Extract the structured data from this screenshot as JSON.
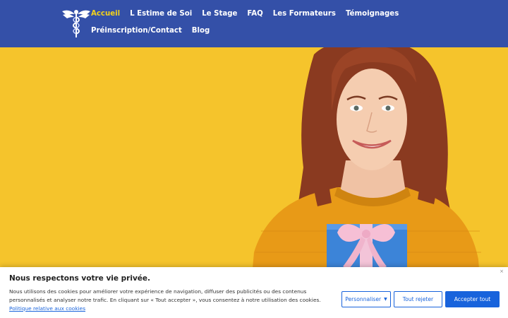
{
  "header": {
    "logo": {
      "icon": "caduceus-logo-icon"
    },
    "nav": [
      {
        "label": "Accueil",
        "active": true
      },
      {
        "label": "L Estime de Soi",
        "active": false
      },
      {
        "label": "Le Stage",
        "active": false
      },
      {
        "label": "FAQ",
        "active": false
      },
      {
        "label": "Les Formateurs",
        "active": false
      },
      {
        "label": "Témoignages",
        "active": false
      },
      {
        "label": "Préinscription/Contact",
        "active": false
      },
      {
        "label": "Blog",
        "active": false
      }
    ]
  },
  "colors": {
    "header_bg": "#3450a8",
    "active_nav": "#f3d21b",
    "hero_bg": "#f5c42c",
    "cookie_accent": "#1863dc"
  },
  "hero": {
    "image": "woman-yellow-sweater-holding-gift-box"
  },
  "cookie": {
    "title": "Nous respectons votre vie privée.",
    "text_line1": "Nous utilisons des cookies pour améliorer votre expérience de navigation, diffuser des publicités ou des contenus personnalisés et analyser notre trafic. En cliquant sur « Tout accepter », vous consentez à notre utilisation des cookies.",
    "policy_link": "Politique relative aux cookies",
    "close_symbol": "×",
    "buttons": {
      "customize": "Personnaliser",
      "reject": "Tout rejeter",
      "accept": "Accepter tout"
    }
  }
}
